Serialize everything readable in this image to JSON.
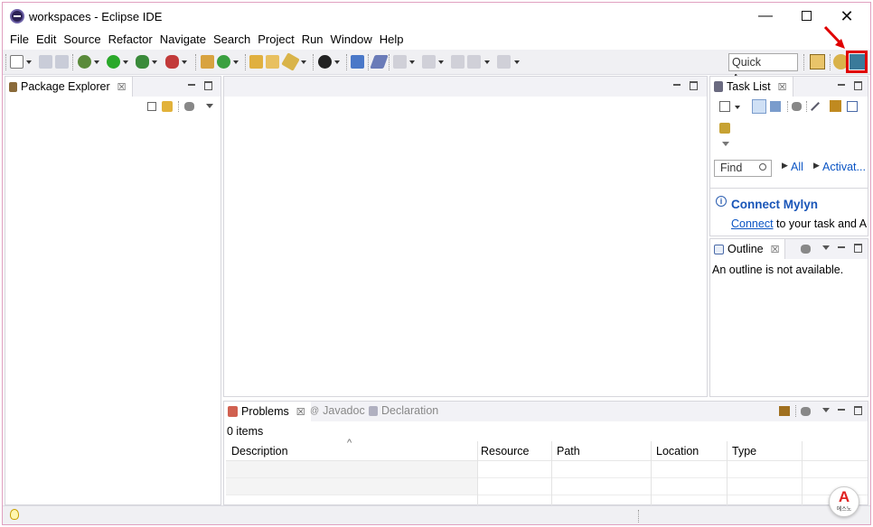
{
  "window": {
    "title": "workspaces - Eclipse IDE",
    "min": "—",
    "close": "✕"
  },
  "menu": [
    "File",
    "Edit",
    "Source",
    "Refactor",
    "Navigate",
    "Search",
    "Project",
    "Run",
    "Window",
    "Help"
  ],
  "toolbar": {
    "quick_access": "Quick Access"
  },
  "package_explorer": {
    "title": "Package Explorer"
  },
  "task_list": {
    "title": "Task List",
    "find_placeholder": "Find",
    "all_label": "All",
    "activate_label": "Activat...",
    "connect_title": "Connect Mylyn",
    "connect_link": "Connect",
    "connect_text": " to your task and AL"
  },
  "outline": {
    "title": "Outline",
    "message": "An outline is not available."
  },
  "bottom": {
    "tabs": [
      "Problems",
      "Javadoc",
      "Declaration"
    ],
    "items_count": "0 items",
    "columns": [
      "Description",
      "Resource",
      "Path",
      "Location",
      "Type"
    ]
  },
  "badge": {
    "letter": "A",
    "caption": "에스노"
  },
  "colors": {
    "highlight": "#e00000",
    "link": "#0b55c4"
  }
}
